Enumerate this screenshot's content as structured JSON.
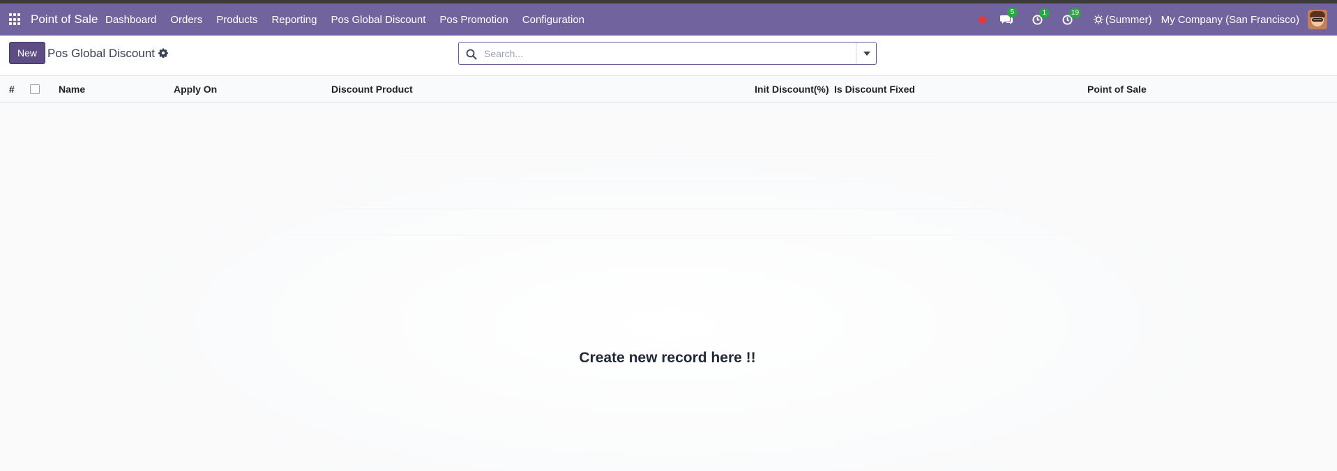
{
  "app": {
    "name": "Point of Sale"
  },
  "menu": [
    "Dashboard",
    "Orders",
    "Products",
    "Reporting",
    "Pos Global Discount",
    "Pos Promotion",
    "Configuration"
  ],
  "systray": {
    "messages_count": "5",
    "activities_count": "1",
    "timer_count": "19",
    "theme_label": "(Summer)",
    "company": "My Company (San Francisco)"
  },
  "control_panel": {
    "new_label": "New",
    "breadcrumb": "Pos Global Discount",
    "search_placeholder": "Search..."
  },
  "table": {
    "columns": [
      "#",
      "Name",
      "Apply On",
      "Discount Product",
      "Init Discount(%)",
      "Is Discount Fixed",
      "Point of Sale"
    ]
  },
  "empty_state": {
    "title": "Create new record here !!"
  },
  "colors": {
    "navbar": "#71639e",
    "primary_button": "#5e4d85",
    "badge": "#28a745",
    "record_dot": "#e53935"
  },
  "icons": [
    "apps-grid-icon",
    "record-icon",
    "chat-icon",
    "activity-clock-icon",
    "timer-icon",
    "sun-icon",
    "gear-icon",
    "search-icon",
    "caret-down-icon"
  ]
}
